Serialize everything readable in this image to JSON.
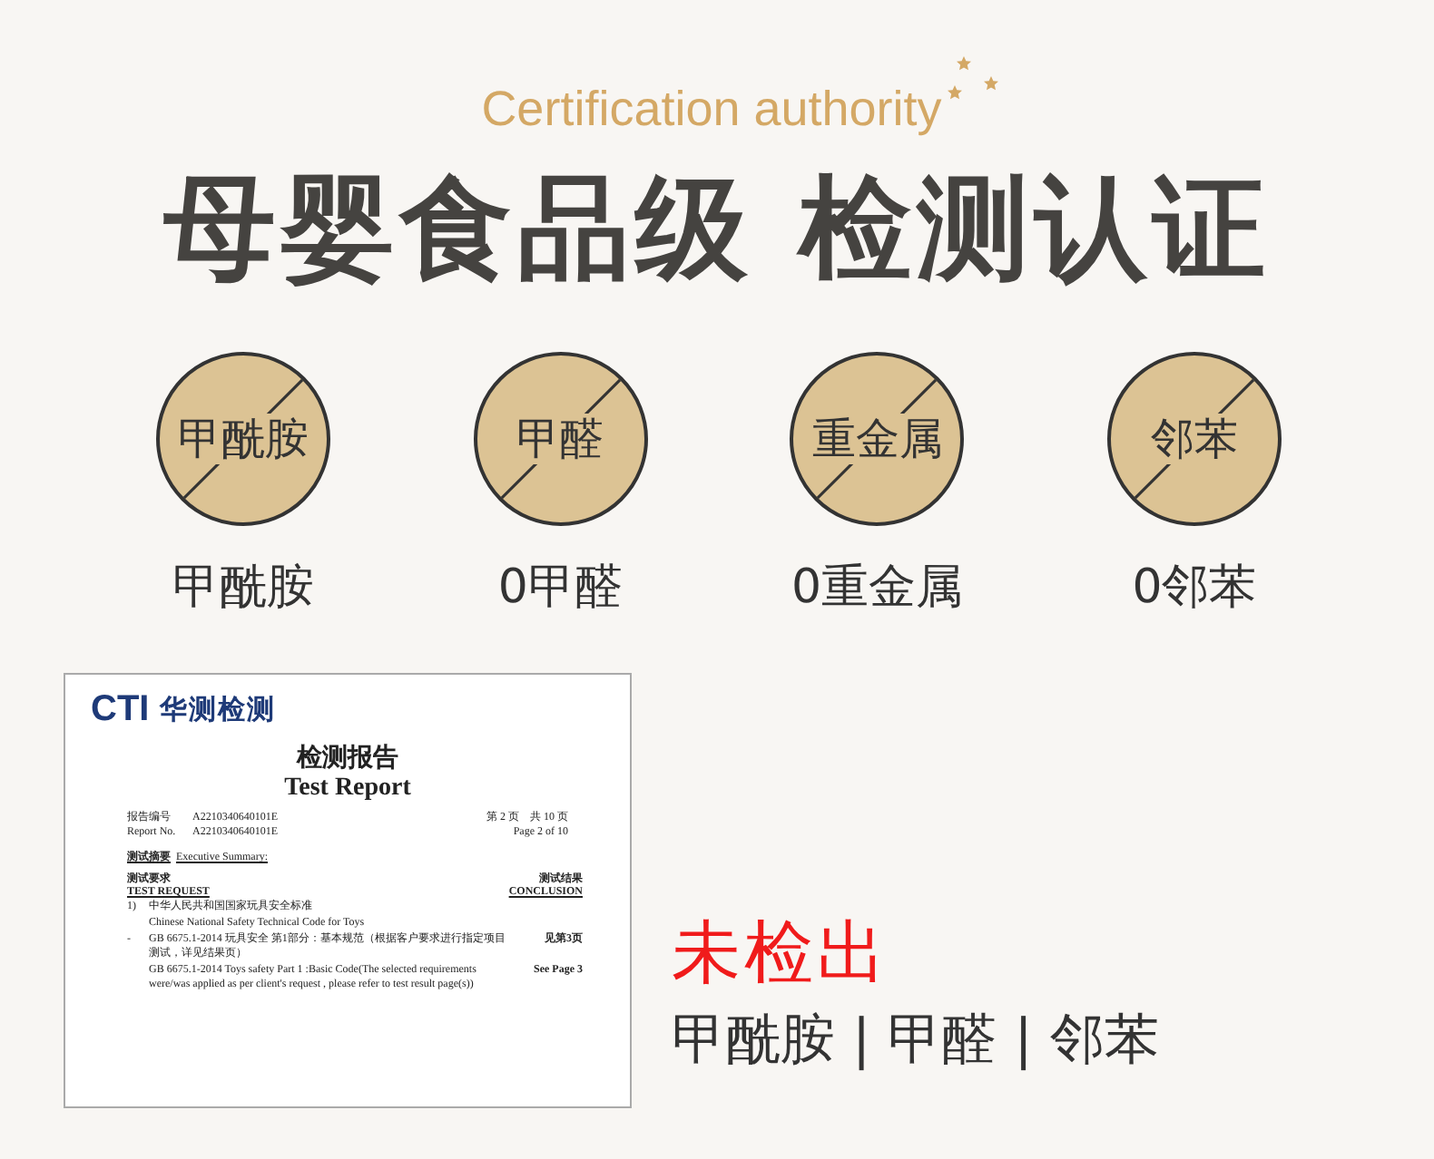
{
  "header": {
    "subtitle": "Certification authority",
    "title": "母婴食品级 检测认证"
  },
  "badges": [
    {
      "symbol": "甲酰胺",
      "label": "甲酰胺"
    },
    {
      "symbol": "甲醛",
      "label": "0甲醛"
    },
    {
      "symbol": "重金属",
      "label": "0重金属"
    },
    {
      "symbol": "邻苯",
      "label": "0邻苯"
    }
  ],
  "report": {
    "logo_mark": "CTI",
    "logo_name": "华测检测",
    "title_cn": "检测报告",
    "title_en": "Test Report",
    "meta": [
      {
        "label": "报告编号",
        "value": "A2210340640101E",
        "page": "第 2 页　共 10 页"
      },
      {
        "label": "Report No.",
        "value": "A2210340640101E",
        "page": "Page 2 of 10"
      }
    ],
    "summary_cn": "测试摘要",
    "summary_en": "Executive Summary:",
    "request_cn": "测试要求",
    "request_en": "TEST REQUEST",
    "conclusion_cn": "测试结果",
    "conclusion_en": "CONCLUSION",
    "items": [
      {
        "marker": "1)",
        "text": "中华人民共和国国家玩具安全标准"
      },
      {
        "text": "Chinese National Safety Technical Code for Toys"
      },
      {
        "marker": "-",
        "text": "GB 6675.1-2014 玩具安全 第1部分：基本规范（根据客户要求进行指定项目测试，详见结果页）",
        "result": "见第3页"
      },
      {
        "text": "GB 6675.1-2014 Toys safety Part 1 :Basic Code(The selected requirements were/was applied as per client's request , please refer to test result page(s))",
        "result": "See Page 3"
      }
    ]
  },
  "result": {
    "headline": "未检出",
    "items": "甲酰胺 | 甲醛 | 邻苯"
  }
}
